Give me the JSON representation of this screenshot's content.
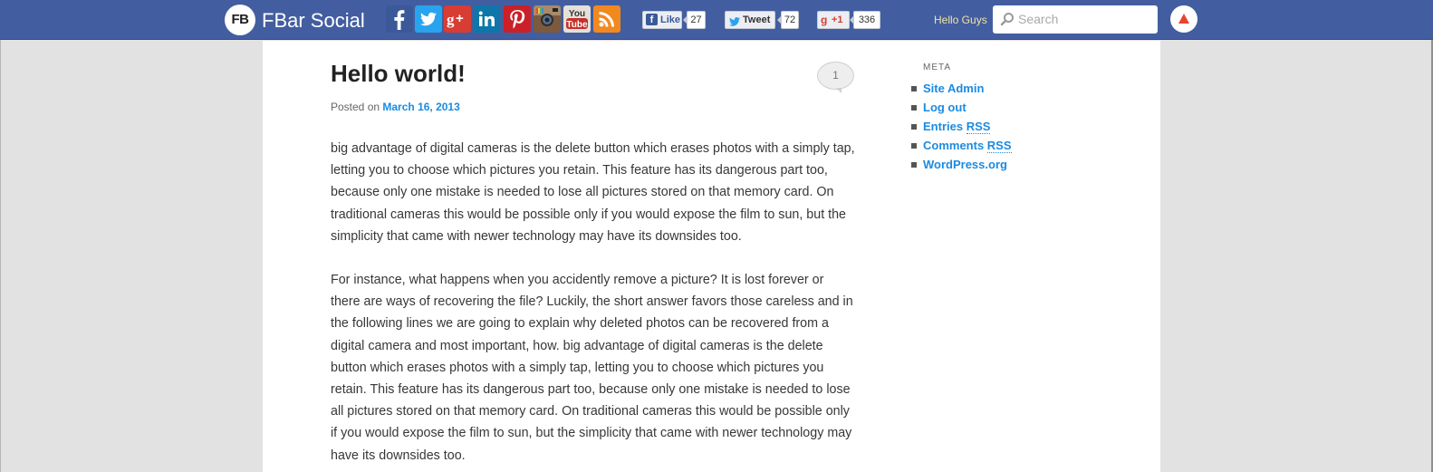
{
  "topbar": {
    "logo_text": "FB",
    "brand": "FBar Social",
    "social_icons": [
      "facebook-icon",
      "twitter-icon",
      "google-plus-icon",
      "linkedin-icon",
      "pinterest-icon",
      "instagram-icon",
      "youtube-icon",
      "rss-icon"
    ],
    "youtube_line1": "You",
    "youtube_line2": "Tube",
    "fb_like": {
      "label": "Like",
      "count": "27"
    },
    "tweet": {
      "label": "Tweet",
      "count": "72"
    },
    "gplus": {
      "label": "+1",
      "count": "336"
    },
    "greeting": "Hello Guys",
    "search_placeholder": "Search"
  },
  "post": {
    "title": "Hello world!",
    "posted_on": "Posted on",
    "date": "March 16, 2013",
    "comment_count": "1",
    "paragraphs": [
      "big advantage of digital cameras is the delete button which erases photos with a simply tap, letting you to choose which pictures you retain. This feature has its dangerous part too, because only one mistake is needed to lose all pictures stored on that memory card. On traditional cameras this would be possible only if you would expose the film to sun, but the simplicity that came with newer technology may have its downsides too.",
      "For instance, what happens when you accidently remove a picture? It is lost forever or there are ways of recovering the file? Luckily, the short answer favors those careless and in the following lines we are going to explain why deleted photos can be recovered from a digital camera and most important, how. big advantage of digital cameras is the delete button which erases photos with a simply tap, letting you to choose which pictures you retain. This feature has its dangerous part too, because only one mistake is needed to lose all pictures stored on that memory card. On traditional cameras this would be possible only if you would expose the film to sun, but the simplicity that came with newer technology may have its downsides too."
    ]
  },
  "sidebar": {
    "title": "META",
    "links": [
      {
        "label": "Site Admin"
      },
      {
        "label": "Log out"
      },
      {
        "label": "Entries ",
        "abbr": "RSS"
      },
      {
        "label": "Comments ",
        "abbr": "RSS"
      },
      {
        "label": "WordPress.org"
      }
    ]
  },
  "colors": {
    "topbar": "#435ea0",
    "link": "#1b8be0",
    "greeting": "#f1e2a0",
    "page_bg": "#e2e2e2"
  }
}
